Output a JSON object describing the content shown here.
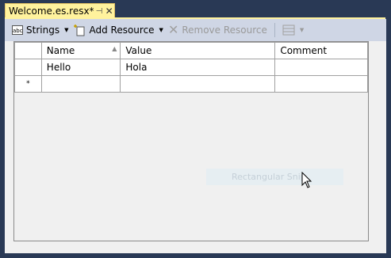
{
  "tab": {
    "title": "Welcome.es.resx*",
    "pin_glyph": "⊣",
    "close_glyph": "✕"
  },
  "toolbar": {
    "strings_label": "Strings",
    "add_resource_label": "Add Resource",
    "remove_resource_label": "Remove Resource"
  },
  "grid": {
    "headers": {
      "name": "Name",
      "value": "Value",
      "comment": "Comment"
    },
    "rows": [
      {
        "name": "Hello",
        "value": "Hola",
        "comment": ""
      }
    ],
    "new_row_marker": "*"
  },
  "overlay": {
    "snip_label": "Rectangular Snip"
  },
  "colors": {
    "background": "#293955",
    "tab_active": "#fff29d",
    "toolbar": "#cfd6e5",
    "content": "#f0f0f0"
  }
}
